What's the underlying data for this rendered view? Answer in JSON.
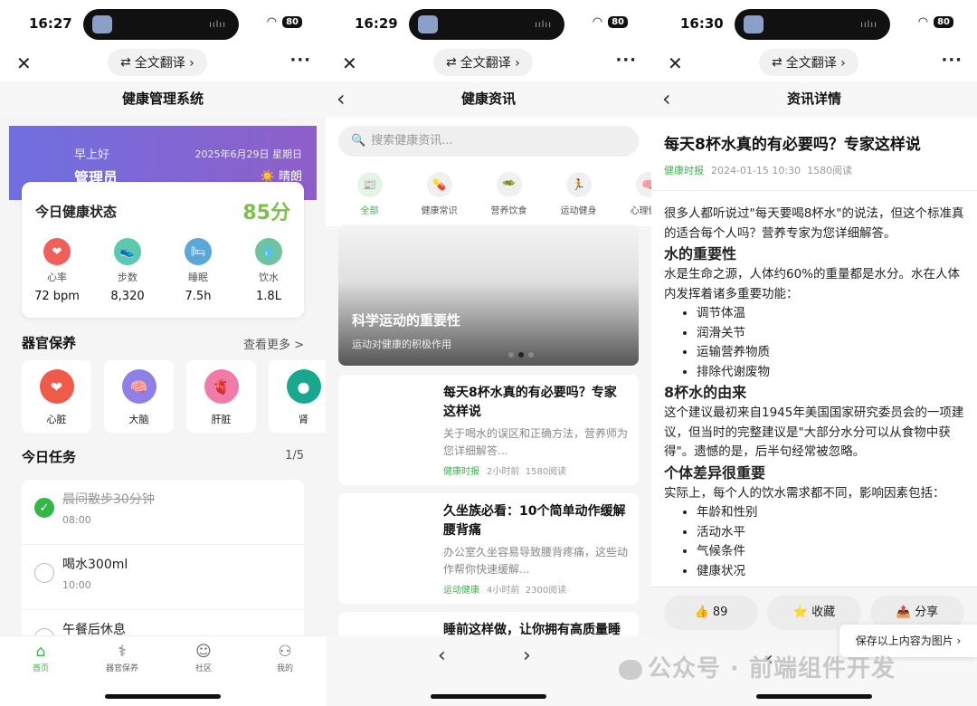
{
  "phones": [
    {
      "time": "16:27",
      "battery": "80"
    },
    {
      "time": "16:29",
      "battery": "80"
    },
    {
      "time": "16:30",
      "battery": "80"
    }
  ],
  "wx": {
    "translate": "全文翻译 ›",
    "more": "···",
    "close": "✕"
  },
  "home": {
    "title": "健康管理系统",
    "greeting": "早上好",
    "username": "管理员",
    "date": "2025年6月29日 星期日",
    "weather": "☀️ 晴朗",
    "health_card": {
      "title": "今日健康状态",
      "score": "85分",
      "metrics": [
        {
          "label": "心率",
          "value": "72 bpm",
          "icon": "heart-icon",
          "color": "#f0605a"
        },
        {
          "label": "步数",
          "value": "8,320",
          "icon": "shoe-icon",
          "color": "#5cc8b0"
        },
        {
          "label": "睡眠",
          "value": "7.5h",
          "icon": "bed-icon",
          "color": "#5aa8d8"
        },
        {
          "label": "饮水",
          "value": "1.8L",
          "icon": "water-icon",
          "color": "#6cc4a0"
        }
      ]
    },
    "organs": {
      "title": "器官保养",
      "more": "查看更多 >",
      "items": [
        {
          "label": "心脏",
          "icon": "heart-icon",
          "color": "#f05a48"
        },
        {
          "label": "大脑",
          "icon": "brain-icon",
          "color": "#8f80e8"
        },
        {
          "label": "肝脏",
          "icon": "liver-icon",
          "color": "#f07aa8"
        },
        {
          "label": "肾",
          "icon": "kidney-icon",
          "color": "#18a890"
        }
      ]
    },
    "tasks": {
      "title": "今日任务",
      "count": "1/5",
      "items": [
        {
          "text": "晨间散步30分钟",
          "time": "08:00",
          "done": true
        },
        {
          "text": "喝水300ml",
          "time": "10:00",
          "done": false
        },
        {
          "text": "午餐后休息",
          "time": "",
          "done": false
        }
      ]
    },
    "tabs": [
      {
        "label": "首页",
        "icon": "home-icon",
        "glyph": "⌂",
        "active": true
      },
      {
        "label": "器官保养",
        "icon": "lungs-icon",
        "glyph": "⚕",
        "active": false
      },
      {
        "label": "社区",
        "icon": "smile-icon",
        "glyph": "☺",
        "active": false
      },
      {
        "label": "我的",
        "icon": "user-icon",
        "glyph": "⚇",
        "active": false
      }
    ]
  },
  "news": {
    "title": "健康资讯",
    "search_placeholder": "搜索健康资讯...",
    "categories": [
      {
        "label": "全部",
        "icon": "newspaper-icon",
        "glyph": "📰",
        "active": true
      },
      {
        "label": "健康常识",
        "icon": "pill-icon",
        "glyph": "💊",
        "active": false
      },
      {
        "label": "营养饮食",
        "icon": "salad-icon",
        "glyph": "🥗",
        "active": false
      },
      {
        "label": "运动健身",
        "icon": "runner-icon",
        "glyph": "🏃",
        "active": false
      },
      {
        "label": "心理健康",
        "icon": "brain-icon",
        "glyph": "🧠",
        "active": false
      }
    ],
    "banner": {
      "title": "科学运动的重要性",
      "subtitle": "运动对健康的积极作用"
    },
    "articles": [
      {
        "title": "每天8杯水真的有必要吗？专家这样说",
        "desc": "关于喝水的误区和正确方法，营养师为您详细解答...",
        "source": "健康时报",
        "time": "2小时前",
        "reads": "1580阅读"
      },
      {
        "title": "久坐族必看：10个简单动作缓解腰背痛",
        "desc": "办公室久坐容易导致腰背疼痛，这些动作帮你快速缓解...",
        "source": "运动健康",
        "time": "4小时前",
        "reads": "2300阅读"
      },
      {
        "title": "睡前这样做，让你拥有高质量睡",
        "desc": "",
        "source": "",
        "time": "",
        "reads": ""
      }
    ]
  },
  "detail": {
    "title": "资讯详情",
    "article_title": "每天8杯水真的有必要吗？专家这样说",
    "source": "健康时报",
    "date": "2024-01-15 10:30",
    "reads": "1580阅读",
    "intro": "很多人都听说过\"每天要喝8杯水\"的说法，但这个标准真的适合每个人吗？营养专家为您详细解答。",
    "h1": "水的重要性",
    "p1": "水是生命之源，人体约60%的重量都是水分。水在人体内发挥着诸多重要功能：",
    "list1": [
      "调节体温",
      "润滑关节",
      "运输营养物质",
      "排除代谢废物"
    ],
    "h2": "8杯水的由来",
    "p2": "这个建议最初来自1945年美国国家研究委员会的一项建议，但当时的完整建议是\"大部分水分可以从食物中获得\"。遗憾的是，后半句经常被忽略。",
    "h3": "个体差异很重要",
    "p3": "实际上，每个人的饮水需求都不同，影响因素包括：",
    "list2": [
      "年龄和性别",
      "活动水平",
      "气候条件",
      "健康状况"
    ],
    "like": "👍 89",
    "fav": "⭐ 收藏",
    "share": "📤 分享",
    "save_image": "保存以上内容为图片 ›",
    "watermark": "公众号 · 前端组件开发"
  }
}
